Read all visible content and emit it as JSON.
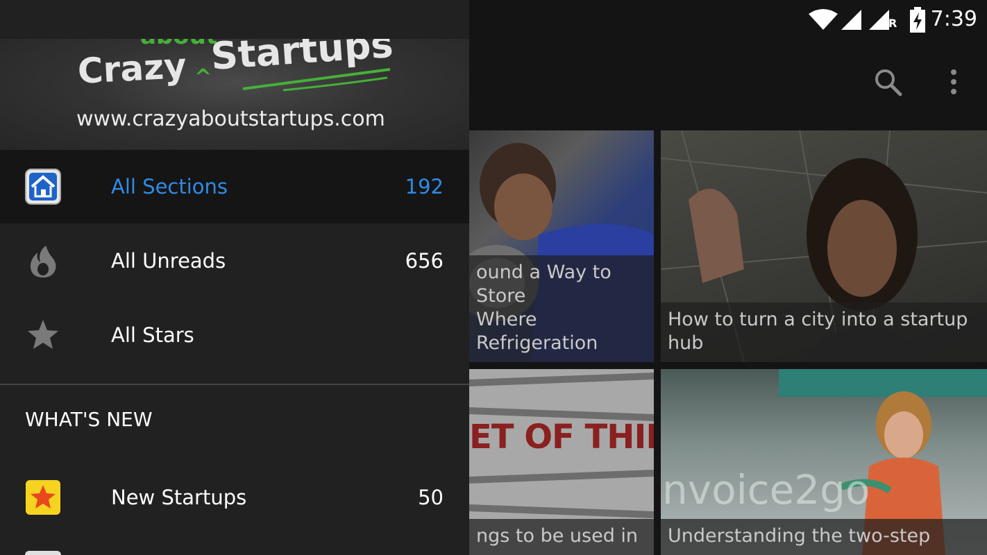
{
  "status_bar": {
    "time": "7:39",
    "roaming_indicator": "R"
  },
  "header": {
    "logo_text_small": "about",
    "logo_text_left": "Crazy",
    "logo_text_right": "Startups",
    "website": "www.crazyaboutstartups.com"
  },
  "drawer": {
    "items": [
      {
        "label": "All Sections",
        "count": "192",
        "icon": "home-icon",
        "active": true
      },
      {
        "label": "All Unreads",
        "count": "656",
        "icon": "flame-icon",
        "active": false
      },
      {
        "label": "All Stars",
        "count": "",
        "icon": "star-icon",
        "active": false
      }
    ],
    "section_title": "WHAT'S NEW",
    "section_items": [
      {
        "label": "New Startups",
        "count": "50",
        "icon": "star-badge-icon"
      }
    ]
  },
  "toolbar": {
    "search_icon": "search-icon",
    "menu_icon": "more-vert-icon"
  },
  "cards": [
    {
      "caption": "ound a Way to Store\nWhere Refrigeration"
    },
    {
      "caption": "How to turn a city into a startup\nhub"
    },
    {
      "caption": "ngs to be used in",
      "image_text": "ET OF THINGS"
    },
    {
      "caption": "Understanding the two-step",
      "image_text": "nvoice2go"
    }
  ],
  "colors": {
    "accent": "#2f8be6",
    "drawer_bg": "#212121",
    "active_bg": "#151515"
  }
}
